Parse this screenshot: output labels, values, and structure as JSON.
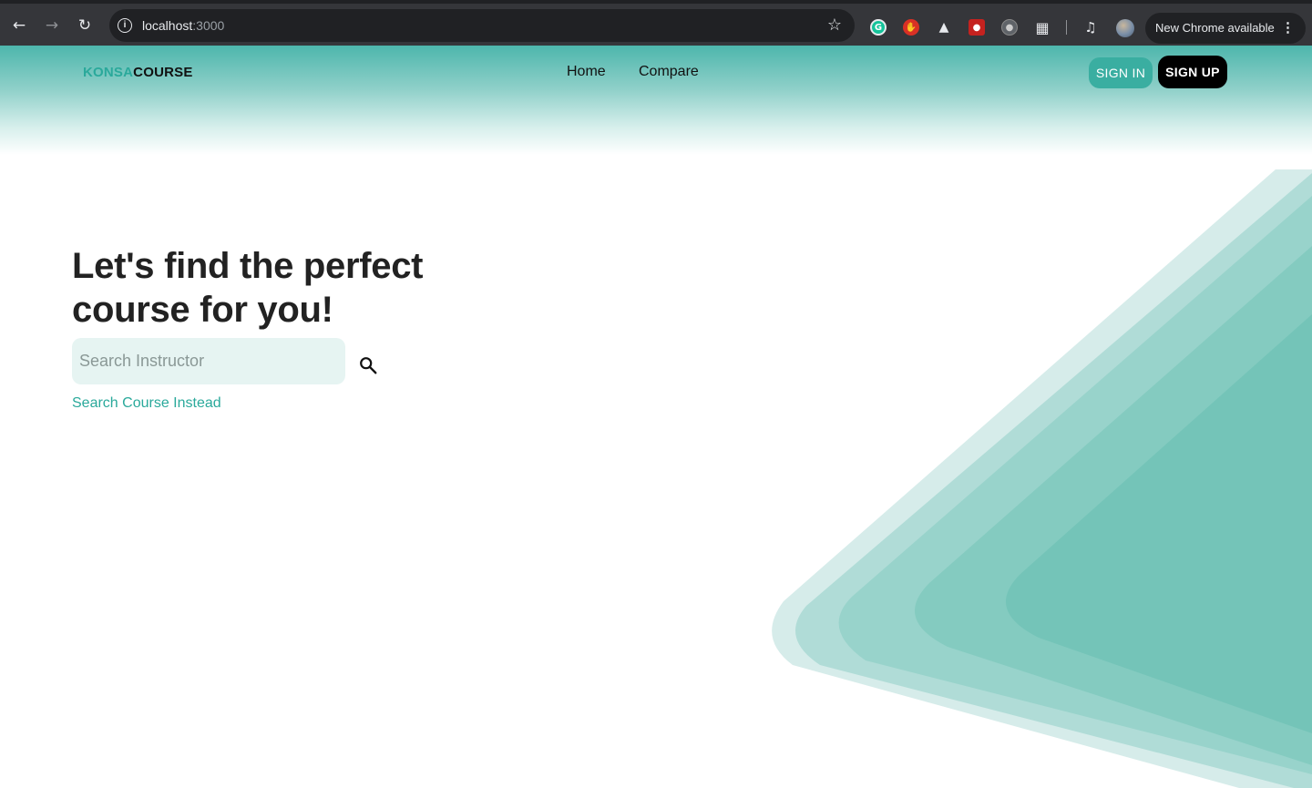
{
  "browser": {
    "url_host": "localhost",
    "url_port": ":3000",
    "update_label": "New Chrome available",
    "icons": [
      "back-arrow-icon",
      "forward-arrow-icon",
      "reload-icon",
      "site-info-icon",
      "bookmark-star-icon",
      "grammarly-extension-icon",
      "block-extension-icon",
      "hat-extension-icon",
      "red-extension-icon",
      "gray-extension-icon",
      "extensions-puzzle-icon",
      "media-control-icon",
      "profile-avatar",
      "kebab-menu-icon"
    ]
  },
  "header": {
    "logo_part_a": "KONSA",
    "logo_part_b": "COURSE",
    "nav": {
      "home": "Home",
      "compare": "Compare"
    },
    "sign_in": "SIGN IN",
    "sign_up": "SIGN UP"
  },
  "hero": {
    "title": "Let's find the perfect course for you!",
    "search_placeholder": "Search Instructor",
    "search_value": "",
    "alt_link": "Search Course Instead"
  },
  "colors": {
    "brand_teal": "#2aa99b",
    "signin_bg": "#3aaea1",
    "signup_bg": "#000000",
    "search_bg": "#e6f4f2",
    "decor_layers": [
      "#d6ecea",
      "#b0dcd7",
      "#98d3cb",
      "#84cbc0",
      "#74c4b8"
    ]
  }
}
